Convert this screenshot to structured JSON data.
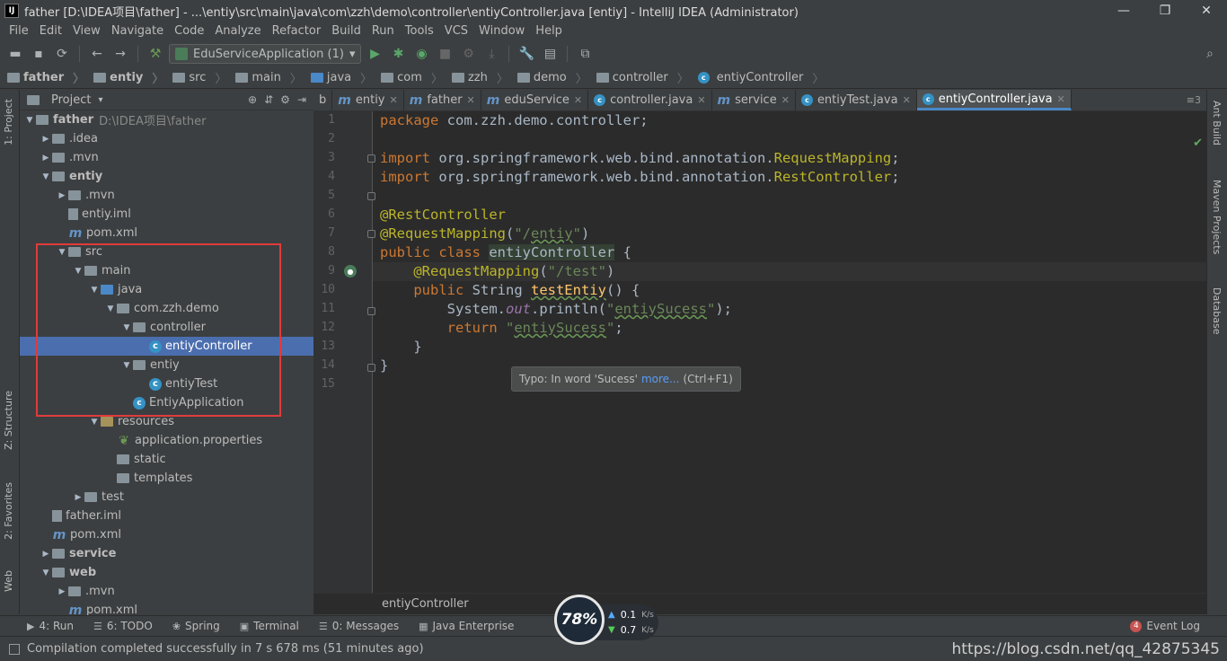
{
  "window": {
    "title": "father [D:\\IDEA项目\\father] - ...\\entiy\\src\\main\\java\\com\\zzh\\demo\\controller\\entiyController.java [entiy] - IntelliJ IDEA (Administrator)",
    "app_icon_text": "IJ"
  },
  "menu": [
    "File",
    "Edit",
    "View",
    "Navigate",
    "Code",
    "Analyze",
    "Refactor",
    "Build",
    "Run",
    "Tools",
    "VCS",
    "Window",
    "Help"
  ],
  "toolbar": {
    "run_config": "EduServiceApplication (1)"
  },
  "breadcrumb": [
    "father",
    "entiy",
    "src",
    "main",
    "java",
    "com",
    "zzh",
    "demo",
    "controller",
    "entiyController"
  ],
  "left_strip": {
    "project": "1: Project",
    "structure": "Z: Structure",
    "favorites": "2: Favorites",
    "web": "Web"
  },
  "project_panel": {
    "title": "Project",
    "tree": [
      {
        "indent": 0,
        "arrow": "▼",
        "icon": "folder",
        "label": "father",
        "bold": true,
        "hint": "D:\\IDEA项目\\father"
      },
      {
        "indent": 1,
        "arrow": "▶",
        "icon": "folder",
        "label": ".idea"
      },
      {
        "indent": 1,
        "arrow": "▶",
        "icon": "folder",
        "label": ".mvn"
      },
      {
        "indent": 1,
        "arrow": "▼",
        "icon": "folder",
        "label": "entiy",
        "bold": true
      },
      {
        "indent": 2,
        "arrow": "▶",
        "icon": "folder",
        "label": ".mvn"
      },
      {
        "indent": 2,
        "arrow": "",
        "icon": "iml",
        "label": "entiy.iml"
      },
      {
        "indent": 2,
        "arrow": "",
        "icon": "maven",
        "label": "pom.xml"
      },
      {
        "indent": 2,
        "arrow": "▼",
        "icon": "folder",
        "label": "src"
      },
      {
        "indent": 3,
        "arrow": "▼",
        "icon": "folder",
        "label": "main"
      },
      {
        "indent": 4,
        "arrow": "▼",
        "icon": "src",
        "label": "java"
      },
      {
        "indent": 5,
        "arrow": "▼",
        "icon": "pkg",
        "label": "com.zzh.demo"
      },
      {
        "indent": 6,
        "arrow": "▼",
        "icon": "pkg",
        "label": "controller"
      },
      {
        "indent": 7,
        "arrow": "",
        "icon": "class",
        "label": "entiyController",
        "selected": true
      },
      {
        "indent": 6,
        "arrow": "▼",
        "icon": "pkg",
        "label": "entiy"
      },
      {
        "indent": 7,
        "arrow": "",
        "icon": "class",
        "label": "entiyTest"
      },
      {
        "indent": 6,
        "arrow": "",
        "icon": "app",
        "label": "EntiyApplication"
      },
      {
        "indent": 4,
        "arrow": "▼",
        "icon": "res",
        "label": "resources"
      },
      {
        "indent": 5,
        "arrow": "",
        "icon": "spring",
        "label": "application.properties"
      },
      {
        "indent": 5,
        "arrow": "",
        "icon": "folder",
        "label": "static"
      },
      {
        "indent": 5,
        "arrow": "",
        "icon": "folder",
        "label": "templates"
      },
      {
        "indent": 3,
        "arrow": "▶",
        "icon": "folder",
        "label": "test"
      },
      {
        "indent": 1,
        "arrow": "",
        "icon": "iml",
        "label": "father.iml"
      },
      {
        "indent": 1,
        "arrow": "",
        "icon": "maven",
        "label": "pom.xml"
      },
      {
        "indent": 1,
        "arrow": "▶",
        "icon": "folder",
        "label": "service",
        "bold": true
      },
      {
        "indent": 1,
        "arrow": "▼",
        "icon": "folder",
        "label": "web",
        "bold": true
      },
      {
        "indent": 2,
        "arrow": "▶",
        "icon": "folder",
        "label": ".mvn"
      },
      {
        "indent": 2,
        "arrow": "",
        "icon": "maven",
        "label": "pom.xml"
      }
    ]
  },
  "tabs": [
    {
      "icon": "",
      "label": "b",
      "close": false
    },
    {
      "icon": "m",
      "label": "entiy",
      "close": true
    },
    {
      "icon": "m",
      "label": "father",
      "close": true
    },
    {
      "icon": "m",
      "label": "eduService",
      "close": true
    },
    {
      "icon": "c",
      "label": "controller.java",
      "close": true
    },
    {
      "icon": "m",
      "label": "service",
      "close": true
    },
    {
      "icon": "c",
      "label": "entiyTest.java",
      "close": true
    },
    {
      "icon": "c",
      "label": "entiyController.java",
      "close": true,
      "active": true
    }
  ],
  "tab_overflow": "≡3",
  "line_numbers": [
    "1",
    "2",
    "3",
    "4",
    "5",
    "6",
    "7",
    "8",
    "9",
    "10",
    "11",
    "12",
    "13",
    "14",
    "15"
  ],
  "tooltip": {
    "prefix": "Typo: In word 'Sucess'",
    "link": "more...",
    "shortcut": "(Ctrl+F1)"
  },
  "editor_breadcrumb": "entiyController",
  "right_strip": [
    "Ant Build",
    "Maven Projects",
    "Database"
  ],
  "bottom_tabs": [
    {
      "icon": "▶",
      "label": "4: Run"
    },
    {
      "icon": "☰",
      "label": "6: TODO"
    },
    {
      "icon": "❀",
      "label": "Spring"
    },
    {
      "icon": "▣",
      "label": "Terminal"
    },
    {
      "icon": "☰",
      "label": "0: Messages"
    },
    {
      "icon": "▦",
      "label": "Java Enterprise"
    }
  ],
  "event_log": {
    "count": "4",
    "label": "Event Log"
  },
  "status": {
    "message": "Compilation completed successfully in 7 s 678 ms (51 minutes ago)",
    "watermark": "https://blog.csdn.net/qq_42875345"
  },
  "net_widget": {
    "percent": "78%",
    "up": "0.1",
    "down": "0.7",
    "unit": "K/s"
  },
  "colors": {
    "selection": "#4b6eaf",
    "highlight_box": "#e03b3b",
    "keyword": "#cc7832",
    "annotation": "#bbb529",
    "string": "#6a8759"
  }
}
